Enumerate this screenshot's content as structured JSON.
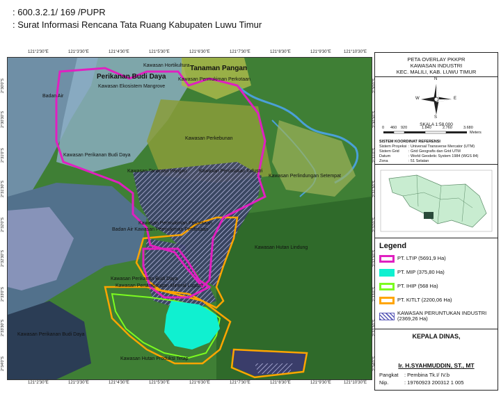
{
  "header": {
    "line1": ": 600.3.2.1/ 169 /PUPR",
    "line2": ": Surat Informasi Rencana Tata Ruang Kabupaten Luwu Timur"
  },
  "map": {
    "top_ticks": [
      "121°2'30\"E",
      "121°3'30\"E",
      "121°4'30\"E",
      "121°5'30\"E",
      "121°6'30\"E",
      "121°7'30\"E",
      "121°8'30\"E",
      "121°9'30\"E",
      "121°10'30\"E"
    ],
    "bottom_ticks": [
      "121°2'30\"E",
      "121°3'30\"E",
      "121°4'30\"E",
      "121°5'30\"E",
      "121°6'30\"E",
      "121°7'30\"E",
      "121°8'30\"E",
      "121°9'30\"E",
      "121°10'30\"E"
    ],
    "left_ticks": [
      "2°30'0\"S",
      "2°30'30\"S",
      "2°31'0\"S",
      "2°31'30\"S",
      "2°32'0\"S",
      "2°32'30\"S",
      "2°33'0\"S",
      "2°33'30\"S",
      "2°34'0\"S"
    ],
    "right_ticks": [
      "2°30'0\"S",
      "2°30'30\"S",
      "2°31'0\"S",
      "2°31'30\"S",
      "2°32'0\"S",
      "2°32'30\"S",
      "2°33'0\"S",
      "2°33'30\"S",
      "2°34'0\"S"
    ],
    "labels": {
      "hortikultura": "Kawasan Hortikultura",
      "tanaman_pangan_top": "Tanaman Pangan",
      "perikanan_budi_daya_big": "Perikanan Budi Daya",
      "permukiman_perkotaan": "Kawasan Permukiman Perkotaan",
      "badan_air": "Badan Air",
      "ekosistem_mangrove": "Kawasan Ekosistem Mangrove",
      "perkebunan": "Kawasan Perkebunan",
      "perikanan_budi_daya": "Kawasan Perikanan Budi Daya",
      "tanaman_pangan": "Kawasan Tanaman Pangan",
      "peruntukan_industri": "Kawasan Peruntukan Industri",
      "perlindungan_setempat": "Kawasan Perlindungan Setempat",
      "permukiman_perdesaan": "Kawasan Permukiman Perdesaan",
      "badan_air_permukiman": "Badan Air Kawasan Permukiman Perdesaan",
      "hutan_lindung": "Kawasan Hutan Lindung",
      "pertambangan": "Kawasan Pertambangan Mineral Logam",
      "perikanan_budi_daya2": "Kawasan Perikanan Budi Daya",
      "perikanan_sw": "Kawasan Perikanan Budi Daya",
      "hutan_produksi_tetap": "Kawasan Hutan Produksi Tetap"
    }
  },
  "panel": {
    "title1": "PETA OVERLAY PKKPR",
    "title2": "KAWASAN INDUSTRI",
    "title3": "KEC. MALILI, KAB. LUWU TIMUR",
    "compass": {
      "n": "N",
      "s": "S",
      "e": "E",
      "w": "W"
    },
    "scale_text": "SKALA 1:58.000",
    "scale_ticks": [
      "0",
      "460",
      "920",
      "1.840",
      "2.760",
      "3.680"
    ],
    "scale_unit": "Meters",
    "crs_title": "SISTEM KOORDINAT REFERENSI",
    "crs_rows": [
      {
        "k": "Sistem Proyeksi",
        "v": ": Universal Transverse Mercator (UTM)"
      },
      {
        "k": "Sistem Grid",
        "v": ": Grid Geografis dan Grid UTM"
      },
      {
        "k": "Datum",
        "v": ": World Geodetic System 1984 (WGS 84)"
      },
      {
        "k": "Zona",
        "v": ": 51 Selatan"
      }
    ],
    "legend_title": "Legend",
    "legend": [
      {
        "label": "PT. LTIP (5691,9 Ha)",
        "color": "#e020c0",
        "type": "outline"
      },
      {
        "label": "PT. MIP (375,80 Ha)",
        "color": "#10f0d0",
        "type": "fill"
      },
      {
        "label": "PT. IHIP (568 Ha)",
        "color": "#7cfc20",
        "type": "outline"
      },
      {
        "label": "PT. KITLT (2200,06 Ha)",
        "color": "#ffa500",
        "type": "outline"
      },
      {
        "label": "KAWASAN PERUNTUKAN INDUSTRI (2369,26 Ha)",
        "color": "#5a5ab8",
        "type": "hatch"
      }
    ],
    "kepala": "KEPALA DINAS,",
    "sign_name": "Ir. H.SYAHMUDDIN, ST., MT",
    "pangkat_k": "Pangkat",
    "pangkat_v": ": Pembina Tk.I/ IV.b",
    "nip_k": "Nip.",
    "nip_v": ": 19760923 200312 1 005"
  },
  "colors": {
    "ltip": "#e020c0",
    "mip": "#10f0d0",
    "ihip": "#7cfc20",
    "kitlt": "#ffa500",
    "industri_hatch": "#5a5ab8"
  }
}
